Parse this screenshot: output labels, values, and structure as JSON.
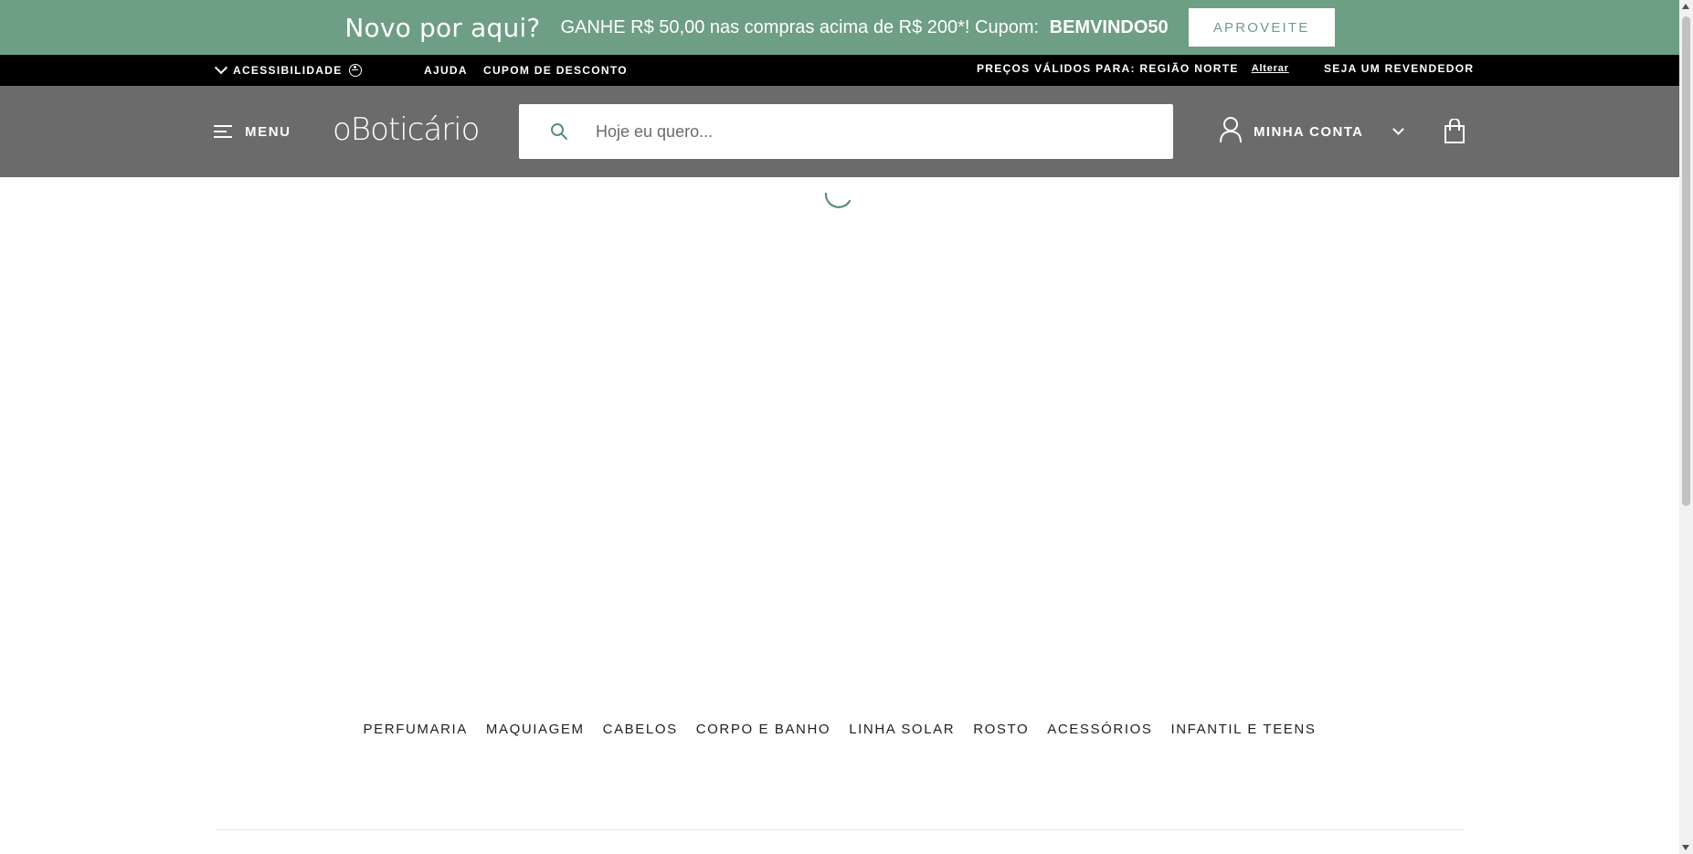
{
  "promo": {
    "headline": "Novo por aqui?",
    "offer_text": "GANHE R$ 50,00 nas compras acima de R$ 200*! Cupom:",
    "coupon_code": "BEMVINDO50",
    "cta_label": "APROVEITE"
  },
  "utility_bar": {
    "accessibility_label": "ACESSIBILIDADE",
    "help_label": "AJUDA",
    "coupon_link": "CUPOM DE DESCONTO",
    "prices_region": "PREÇOS VÁLIDOS PARA: REGIÃO NORTE",
    "change_link": "Alterar",
    "reseller_link": "SEJA UM REVENDEDOR"
  },
  "header": {
    "menu_label": "MENU",
    "logo_text": "oBoticário",
    "search_placeholder": "Hoje eu quero...",
    "account_label": "MINHA CONTA"
  },
  "categories": [
    "PERFUMARIA",
    "MAQUIAGEM",
    "CABELOS",
    "CORPO E BANHO",
    "LINHA SOLAR",
    "ROSTO",
    "ACESSÓRIOS",
    "INFANTIL E TEENS"
  ],
  "colors": {
    "promo_bg": "#6e9e84",
    "header_bg": "#6b6b6b",
    "utility_bg": "#000000",
    "accent": "#5a8f74"
  },
  "icons": {
    "accessibility": "accessibility-icon",
    "menu": "hamburger-icon",
    "search": "search-icon",
    "account": "user-icon",
    "bag": "shopping-bag-icon",
    "loader": "loading-spinner-icon"
  }
}
